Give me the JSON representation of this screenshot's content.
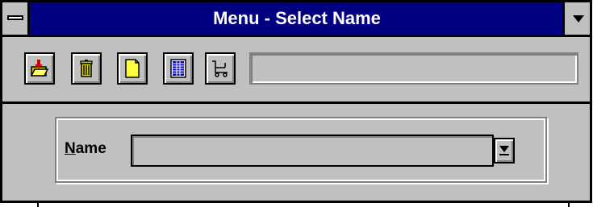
{
  "window": {
    "title": "Menu - Select Name"
  },
  "toolbar": {
    "buttons": [
      {
        "icon": "open-folder-icon"
      },
      {
        "icon": "trash-icon"
      },
      {
        "icon": "new-document-icon"
      },
      {
        "icon": "list-icon"
      },
      {
        "icon": "cart-icon"
      }
    ],
    "field_value": ""
  },
  "form": {
    "name_label_accel": "N",
    "name_label_rest": "ame",
    "name_value": ""
  }
}
